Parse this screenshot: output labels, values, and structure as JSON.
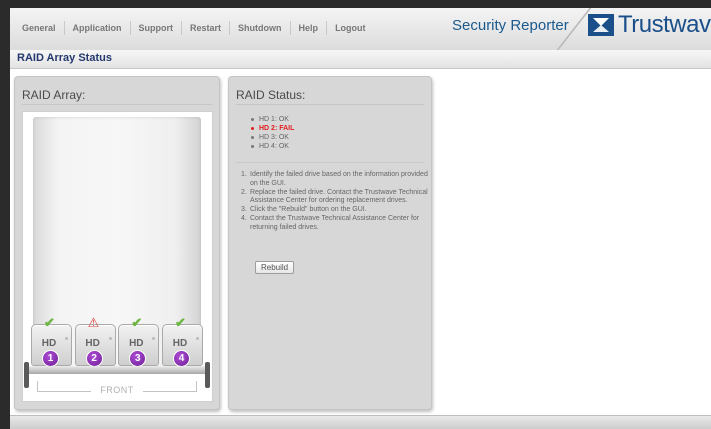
{
  "nav": {
    "items": [
      "General",
      "Application",
      "Support",
      "Restart",
      "Shutdown",
      "Help",
      "Logout"
    ],
    "product_name": "Security Reporter",
    "brand": "Trustwave",
    "brand_color": "#1a4f8a"
  },
  "page": {
    "title": "RAID Array Status"
  },
  "raid_array": {
    "title": "RAID Array:",
    "bays": [
      {
        "label": "HD",
        "number": "1",
        "status": "ok",
        "icon": "check-icon"
      },
      {
        "label": "HD",
        "number": "2",
        "status": "fail",
        "icon": "warning-icon"
      },
      {
        "label": "HD",
        "number": "3",
        "status": "ok",
        "icon": "check-icon"
      },
      {
        "label": "HD",
        "number": "4",
        "status": "ok",
        "icon": "check-icon"
      }
    ],
    "front_label": "FRONT"
  },
  "raid_status": {
    "title": "RAID Status:",
    "drives": [
      {
        "text": "HD 1: OK",
        "state": "ok"
      },
      {
        "text": "HD 2: FAIL",
        "state": "fail"
      },
      {
        "text": "HD 3: OK",
        "state": "ok"
      },
      {
        "text": "HD 4: OK",
        "state": "ok"
      }
    ],
    "steps": [
      "Identify the failed drive based on the information provided on the GUI.",
      "Replace the failed drive. Contact the Trustwave Technical Assistance Center for ordering replacement drives.",
      "Click the \"Rebuild\" button on the GUI.",
      "Contact the Trustwave Technical Assistance Center for returning failed drives."
    ],
    "rebuild_label": "Rebuild",
    "fail_color": "#e01e1e"
  }
}
